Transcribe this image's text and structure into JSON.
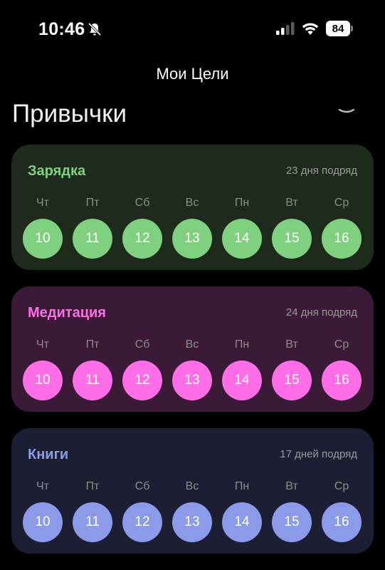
{
  "status_bar": {
    "time": "10:46",
    "battery": "84",
    "icons": [
      "bell-slash-icon",
      "cellular-signal-icon",
      "wifi-icon",
      "battery-icon"
    ]
  },
  "header": {
    "title": "Мои Цели",
    "section": "Привычки",
    "toggle_icon": "chevron-down-icon"
  },
  "habits": [
    {
      "name": "Зарядка",
      "streak": "23 дня подряд",
      "accent": "#7fd17f",
      "card_bg": "#1e2a1c",
      "days": [
        {
          "label": "Чт",
          "num": "10"
        },
        {
          "label": "Пт",
          "num": "11"
        },
        {
          "label": "Сб",
          "num": "12"
        },
        {
          "label": "Вс",
          "num": "13"
        },
        {
          "label": "Пн",
          "num": "14"
        },
        {
          "label": "Вт",
          "num": "15"
        },
        {
          "label": "Ср",
          "num": "16"
        }
      ]
    },
    {
      "name": "Медитация",
      "streak": "24 дня подряд",
      "accent": "#ff6ee6",
      "card_bg": "#3a1a36",
      "days": [
        {
          "label": "Чт",
          "num": "10"
        },
        {
          "label": "Пт",
          "num": "11"
        },
        {
          "label": "Сб",
          "num": "12"
        },
        {
          "label": "Вс",
          "num": "13"
        },
        {
          "label": "Пн",
          "num": "14"
        },
        {
          "label": "Вт",
          "num": "15"
        },
        {
          "label": "Ср",
          "num": "16"
        }
      ]
    },
    {
      "name": "Книги",
      "streak": "17 дней подряд",
      "accent": "#8b9bea",
      "card_bg": "#1c1f33",
      "days": [
        {
          "label": "Чт",
          "num": "10"
        },
        {
          "label": "Пт",
          "num": "11"
        },
        {
          "label": "Сб",
          "num": "12"
        },
        {
          "label": "Вс",
          "num": "13"
        },
        {
          "label": "Пн",
          "num": "14"
        },
        {
          "label": "Вт",
          "num": "15"
        },
        {
          "label": "Ср",
          "num": "16"
        }
      ]
    }
  ]
}
